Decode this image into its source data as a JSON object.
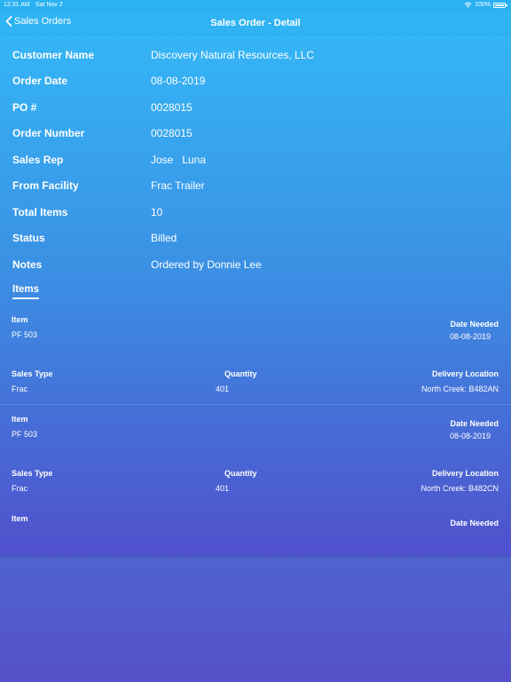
{
  "status_bar": {
    "time": "12:31 AM",
    "date": "Sat Nov 2",
    "battery": "100%"
  },
  "nav": {
    "back_label": "Sales Orders",
    "title": "Sales Order - Detail"
  },
  "fields": [
    {
      "label": "Customer Name",
      "value": "Discovery Natural Resources, LLC"
    },
    {
      "label": "Order Date",
      "value": "08-08-2019"
    },
    {
      "label": "PO #",
      "value": "0028015"
    },
    {
      "label": "Order Number",
      "value": "0028015"
    },
    {
      "label": "Sales Rep",
      "value": "Jose   Luna"
    },
    {
      "label": "From Facility",
      "value": "Frac Trailer"
    },
    {
      "label": "Total Items",
      "value": "10"
    },
    {
      "label": "Status",
      "value": "Billed"
    },
    {
      "label": "Notes",
      "value": "Ordered by Donnie Lee"
    }
  ],
  "items_tab": "Items",
  "item_headers": {
    "item": "Item",
    "date_needed": "Date Needed",
    "sales_type": "Sales Type",
    "quantity": "Quantity",
    "delivery_location": "Delivery Location"
  },
  "items": [
    {
      "item": "PF 503",
      "date_needed": "08-08-2019",
      "sales_type": "Frac",
      "quantity": "401",
      "delivery_location": "North Creek: B482AN"
    },
    {
      "item": "PF 503",
      "date_needed": "08-08-2019",
      "sales_type": "Frac",
      "quantity": "401",
      "delivery_location": "North Creek: B482CN"
    }
  ]
}
